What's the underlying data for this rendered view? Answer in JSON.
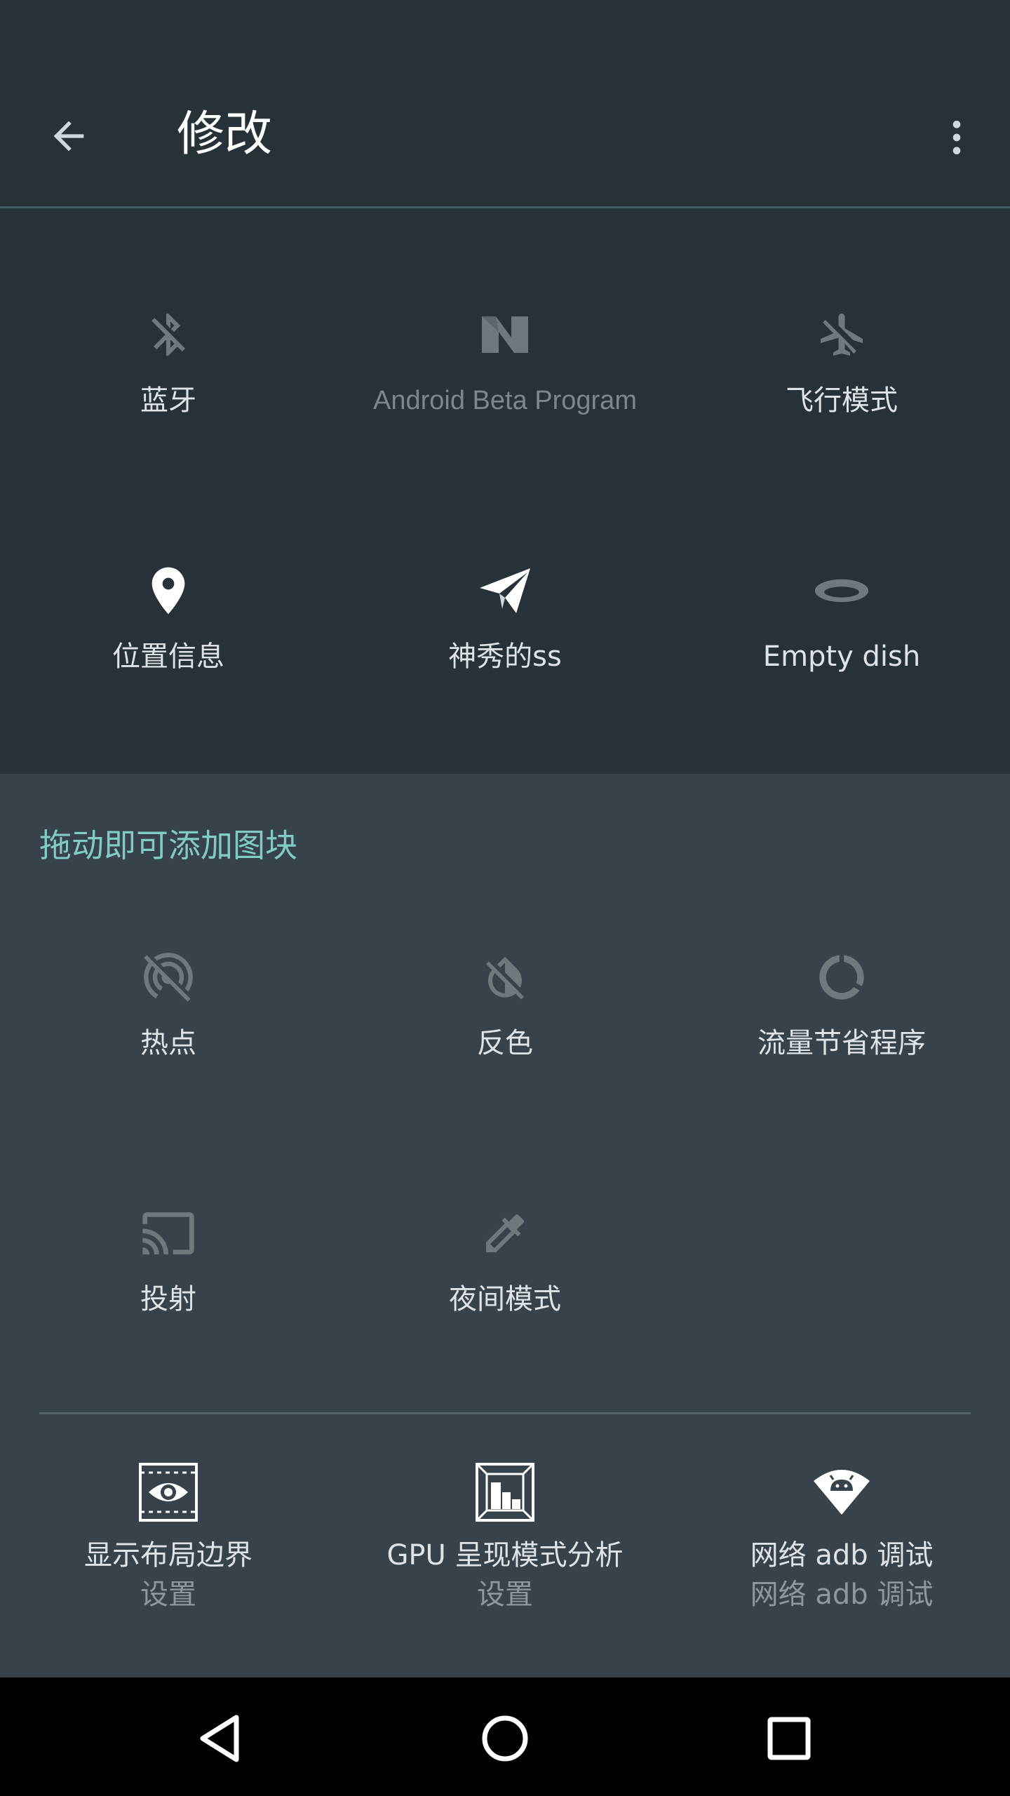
{
  "app_bar": {
    "title": "修改",
    "back_icon": "arrow-back-icon",
    "overflow_icon": "more-vert-icon"
  },
  "active_tiles": [
    {
      "label": "蓝牙",
      "icon": "bluetooth-off-icon",
      "dim": false
    },
    {
      "label": "Android Beta Program",
      "icon": "android-n-icon",
      "dim": true
    },
    {
      "label": "飞行模式",
      "icon": "airplane-off-icon",
      "dim": false
    },
    {
      "label": "位置信息",
      "icon": "location-pin-icon",
      "dim": false
    },
    {
      "label": "神秀的ss",
      "icon": "paper-plane-icon",
      "dim": false
    },
    {
      "label": "Empty dish",
      "icon": "empty-dish-icon",
      "dim": false
    }
  ],
  "available": {
    "header": "拖动即可添加图块",
    "tiles": [
      {
        "label": "热点",
        "icon": "hotspot-off-icon"
      },
      {
        "label": "反色",
        "icon": "invert-colors-off-icon"
      },
      {
        "label": "流量节省程序",
        "icon": "data-saver-icon"
      },
      {
        "label": "投射",
        "icon": "cast-icon"
      },
      {
        "label": "夜间模式",
        "icon": "eyedropper-icon"
      }
    ],
    "dev_tiles": [
      {
        "label": "显示布局边界",
        "sub": "设置",
        "icon": "layout-bounds-icon"
      },
      {
        "label": "GPU 呈现模式分析",
        "sub": "设置",
        "icon": "gpu-profile-icon"
      },
      {
        "label": "网络 adb 调试",
        "sub": "网络 adb 调试",
        "icon": "adb-wifi-icon"
      }
    ]
  },
  "nav_bar": {
    "back": "nav-back-icon",
    "home": "nav-home-icon",
    "recents": "nav-recents-icon"
  },
  "colors": {
    "background": "#263238",
    "available_background": "#37424a",
    "accent": "#80cbc4",
    "nav_bar": "#000000"
  }
}
